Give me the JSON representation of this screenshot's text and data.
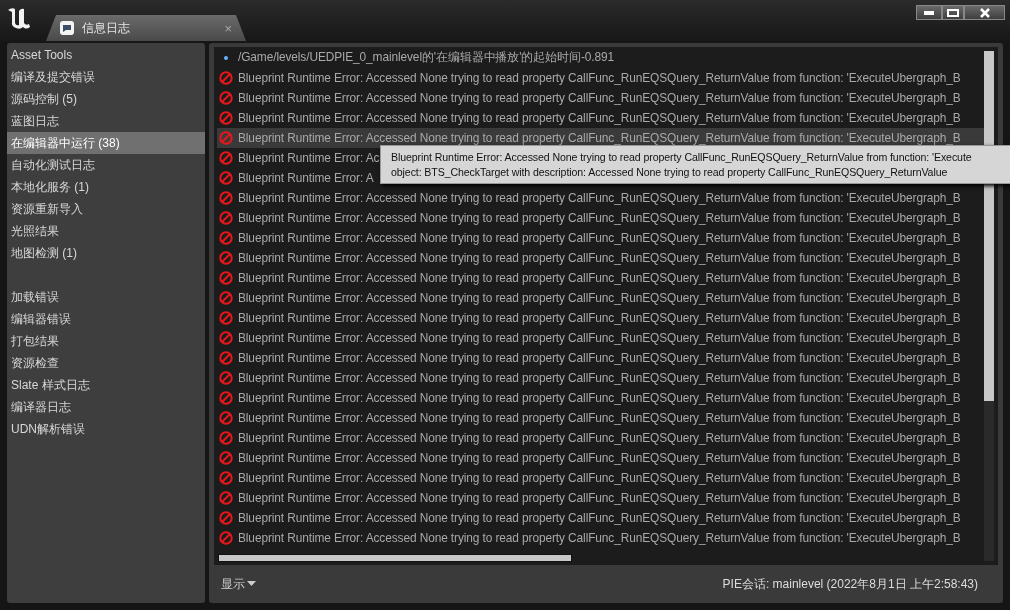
{
  "window": {
    "tab": {
      "label": "信息日志",
      "close": "×"
    }
  },
  "sidebar": {
    "groups": [
      [
        {
          "label": "Asset Tools",
          "selected": false
        },
        {
          "label": "编译及提交错误",
          "selected": false
        },
        {
          "label": "源码控制 (5)",
          "selected": false
        },
        {
          "label": "蓝图日志",
          "selected": false
        },
        {
          "label": "在编辑器中运行 (38)",
          "selected": true
        },
        {
          "label": "自动化测试日志",
          "selected": false
        },
        {
          "label": "本地化服务 (1)",
          "selected": false
        },
        {
          "label": "资源重新导入",
          "selected": false
        },
        {
          "label": "光照结果",
          "selected": false
        },
        {
          "label": "地图检测 (1)",
          "selected": false
        }
      ],
      [
        {
          "label": "加载错误",
          "selected": false
        },
        {
          "label": "编辑器错误",
          "selected": false
        },
        {
          "label": "打包结果",
          "selected": false
        },
        {
          "label": "资源检查",
          "selected": false
        },
        {
          "label": "Slate 样式日志",
          "selected": false
        },
        {
          "label": "编译器日志",
          "selected": false
        },
        {
          "label": "UDN解析错误",
          "selected": false
        }
      ]
    ]
  },
  "log": {
    "rows": [
      {
        "kind": "info",
        "text": "/Game/levels/UEDPIE_0_mainlevel的'在编辑器中播放'的起始时间-0.891",
        "selected": false
      },
      {
        "kind": "error",
        "text": "Blueprint Runtime Error: Accessed None trying to read property CallFunc_RunEQSQuery_ReturnValue from function: 'ExecuteUbergraph_B",
        "selected": false
      },
      {
        "kind": "error",
        "text": "Blueprint Runtime Error: Accessed None trying to read property CallFunc_RunEQSQuery_ReturnValue from function: 'ExecuteUbergraph_B",
        "selected": false
      },
      {
        "kind": "error",
        "text": "Blueprint Runtime Error: Accessed None trying to read property CallFunc_RunEQSQuery_ReturnValue from function: 'ExecuteUbergraph_B",
        "selected": false
      },
      {
        "kind": "error",
        "text": "Blueprint Runtime Error: Accessed None trying to read property CallFunc_RunEQSQuery_ReturnValue from function: 'ExecuteUbergraph_B",
        "selected": true
      },
      {
        "kind": "error",
        "text": "Blueprint Runtime Error: Ac",
        "selected": false
      },
      {
        "kind": "error",
        "text": "Blueprint Runtime Error: A",
        "selected": false
      },
      {
        "kind": "error",
        "text": "Blueprint Runtime Error: Accessed None trying to read property CallFunc_RunEQSQuery_ReturnValue from function: 'ExecuteUbergraph_B",
        "selected": false
      },
      {
        "kind": "error",
        "text": "Blueprint Runtime Error: Accessed None trying to read property CallFunc_RunEQSQuery_ReturnValue from function: 'ExecuteUbergraph_B",
        "selected": false
      },
      {
        "kind": "error",
        "text": "Blueprint Runtime Error: Accessed None trying to read property CallFunc_RunEQSQuery_ReturnValue from function: 'ExecuteUbergraph_B",
        "selected": false
      },
      {
        "kind": "error",
        "text": "Blueprint Runtime Error: Accessed None trying to read property CallFunc_RunEQSQuery_ReturnValue from function: 'ExecuteUbergraph_B",
        "selected": false
      },
      {
        "kind": "error",
        "text": "Blueprint Runtime Error: Accessed None trying to read property CallFunc_RunEQSQuery_ReturnValue from function: 'ExecuteUbergraph_B",
        "selected": false
      },
      {
        "kind": "error",
        "text": "Blueprint Runtime Error: Accessed None trying to read property CallFunc_RunEQSQuery_ReturnValue from function: 'ExecuteUbergraph_B",
        "selected": false
      },
      {
        "kind": "error",
        "text": "Blueprint Runtime Error: Accessed None trying to read property CallFunc_RunEQSQuery_ReturnValue from function: 'ExecuteUbergraph_B",
        "selected": false
      },
      {
        "kind": "error",
        "text": "Blueprint Runtime Error: Accessed None trying to read property CallFunc_RunEQSQuery_ReturnValue from function: 'ExecuteUbergraph_B",
        "selected": false
      },
      {
        "kind": "error",
        "text": "Blueprint Runtime Error: Accessed None trying to read property CallFunc_RunEQSQuery_ReturnValue from function: 'ExecuteUbergraph_B",
        "selected": false
      },
      {
        "kind": "error",
        "text": "Blueprint Runtime Error: Accessed None trying to read property CallFunc_RunEQSQuery_ReturnValue from function: 'ExecuteUbergraph_B",
        "selected": false
      },
      {
        "kind": "error",
        "text": "Blueprint Runtime Error: Accessed None trying to read property CallFunc_RunEQSQuery_ReturnValue from function: 'ExecuteUbergraph_B",
        "selected": false
      },
      {
        "kind": "error",
        "text": "Blueprint Runtime Error: Accessed None trying to read property CallFunc_RunEQSQuery_ReturnValue from function: 'ExecuteUbergraph_B",
        "selected": false
      },
      {
        "kind": "error",
        "text": "Blueprint Runtime Error: Accessed None trying to read property CallFunc_RunEQSQuery_ReturnValue from function: 'ExecuteUbergraph_B",
        "selected": false
      },
      {
        "kind": "error",
        "text": "Blueprint Runtime Error: Accessed None trying to read property CallFunc_RunEQSQuery_ReturnValue from function: 'ExecuteUbergraph_B",
        "selected": false
      },
      {
        "kind": "error",
        "text": "Blueprint Runtime Error: Accessed None trying to read property CallFunc_RunEQSQuery_ReturnValue from function: 'ExecuteUbergraph_B",
        "selected": false
      },
      {
        "kind": "error",
        "text": "Blueprint Runtime Error: Accessed None trying to read property CallFunc_RunEQSQuery_ReturnValue from function: 'ExecuteUbergraph_B",
        "selected": false
      },
      {
        "kind": "error",
        "text": "Blueprint Runtime Error: Accessed None trying to read property CallFunc_RunEQSQuery_ReturnValue from function: 'ExecuteUbergraph_B",
        "selected": false
      },
      {
        "kind": "error",
        "text": "Blueprint Runtime Error: Accessed None trying to read property CallFunc_RunEQSQuery_ReturnValue from function: 'ExecuteUbergraph_B",
        "selected": false
      }
    ],
    "tooltip": [
      "Blueprint Runtime Error: Accessed None trying to read property CallFunc_RunEQSQuery_ReturnValue from function: 'Execute",
      "object: BTS_CheckTarget with description: Accessed None trying to read property CallFunc_RunEQSQuery_ReturnValue"
    ]
  },
  "footer": {
    "show_menu": "显示",
    "status": "PIE会话: mainlevel (2022年8月1日 上午2:58:43)"
  }
}
